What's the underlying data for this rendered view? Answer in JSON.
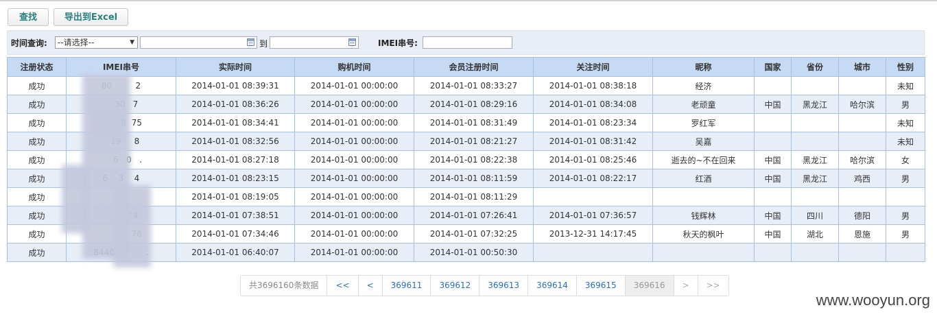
{
  "toolbar": {
    "search_label": "查找",
    "export_label": "导出到Excel"
  },
  "filter": {
    "time_label": "时间查询:",
    "select_value": "--请选择--",
    "to_label": "到",
    "imei_label": "IMEI串号:"
  },
  "table": {
    "headers": [
      "注册状态",
      "IMEI串号",
      "实际时间",
      "购机时间",
      "会员注册时间",
      "关注时间",
      "昵称",
      "国家",
      "省份",
      "城市",
      "性别"
    ],
    "rows": [
      [
        "成功",
        "80         2",
        "2014-01-01 08:39:31",
        "2014-01-01 00:00:00",
        "2014-01-01 08:33:27",
        "2014-01-01 08:38:18",
        "经济",
        "",
        "",
        "",
        "未知"
      ],
      [
        "成功",
        "    30   7",
        "2014-01-01 08:36:26",
        "2014-01-01 00:00:00",
        "2014-01-01 08:29:16",
        "2014-01-01 08:34:08",
        "老顽童",
        "中国",
        "黑龙江",
        "哈尔滨",
        "男"
      ],
      [
        "成功",
        "60918  75",
        "2014-01-01 08:34:41",
        "2014-01-01 00:00:00",
        "2014-01-01 08:31:49",
        "2014-01-01 08:23:34",
        "罗红军",
        "",
        "",
        "",
        "未知"
      ],
      [
        "成功",
        "   19     8",
        "2014-01-01 08:32:56",
        "2014-01-01 00:00:00",
        "2014-01-01 08:21:27",
        "2014-01-01 08:31:42",
        "吴嘉",
        "",
        "",
        "",
        "未知"
      ],
      [
        "成功",
        "     6   0   .",
        "2014-01-01 08:27:18",
        "2014-01-01 00:00:00",
        "2014-01-01 08:22:38",
        "2014-01-01 08:25:46",
        "逝去的~不在回来",
        "中国",
        "黑龙江",
        "哈尔滨",
        "女"
      ],
      [
        "成功",
        "6    3    4",
        "2014-01-01 08:23:15",
        "2014-01-01 00:00:00",
        "2014-01-01 08:11:59",
        "2014-01-01 08:22:17",
        "红酒",
        "中国",
        "黑龙江",
        "鸡西",
        "男"
      ],
      [
        "成功",
        "6",
        "2014-01-01 08:19:05",
        "2014-01-01 00:00:00",
        "2014-01-01 08:11:29",
        "",
        "",
        "",
        "",
        "",
        ""
      ],
      [
        "成功",
        "         24",
        "2014-01-01 07:38:51",
        "2014-01-01 00:00:00",
        "2014-01-01 07:26:41",
        "2014-01-01 07:36:57",
        "钱辉林",
        "中国",
        "四川",
        "德阳",
        "男"
      ],
      [
        "成功",
        "            78",
        "2014-01-01 07:34:46",
        "2014-01-01 00:00:00",
        "2014-01-01 07:32:25",
        "2013-12-31 14:17:45",
        "秋天的枫叶",
        "中国",
        "湖北",
        "恩施",
        "男"
      ],
      [
        "成功",
        "8440            .",
        "2014-01-01 06:40:07",
        "2014-01-01 00:00:00",
        "2014-01-01 00:50:30",
        "",
        "",
        "",
        "",
        "",
        ""
      ]
    ]
  },
  "pager": {
    "total": "共3696160条数据",
    "first": "<<",
    "prev": "<",
    "pages": [
      "369611",
      "369612",
      "369613",
      "369614",
      "369615"
    ],
    "current": "369616",
    "next": ">",
    "last": ">>"
  },
  "watermark": "www.wooyun.org"
}
